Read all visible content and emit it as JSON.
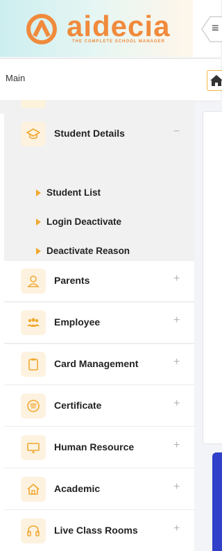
{
  "brand": {
    "name": "aidecia",
    "tagline": "THE COMPLETE SCHOOL MANAGER",
    "accent": "#f08a3c"
  },
  "header": {
    "menu_icon": "hamburger-icon"
  },
  "breadcrumb": {
    "label": "Main",
    "home_icon": "home-icon"
  },
  "sidebar": {
    "active_item": {
      "label": "Student Details",
      "icon": "graduation-cap-icon",
      "toggle": "−",
      "sub_items": [
        {
          "label": "Student List"
        },
        {
          "label": "Login Deactivate"
        },
        {
          "label": "Deactivate Reason"
        }
      ]
    },
    "items": [
      {
        "label": "Parents",
        "icon": "user-icon",
        "toggle": "+"
      },
      {
        "label": "Employee",
        "icon": "group-icon",
        "toggle": "+"
      },
      {
        "label": "Card Management",
        "icon": "clipboard-icon",
        "toggle": "+"
      },
      {
        "label": "Certificate",
        "icon": "certificate-icon",
        "toggle": "+"
      },
      {
        "label": "Human Resource",
        "icon": "monitor-icon",
        "toggle": "+"
      },
      {
        "label": "Academic",
        "icon": "home-outline-icon",
        "toggle": "+"
      },
      {
        "label": "Live Class Rooms",
        "icon": "headset-icon",
        "toggle": "+"
      }
    ]
  },
  "colors": {
    "icon_bg": "#fdf2df",
    "icon_fg": "#f0a830",
    "sub_arrow": "#f0a830",
    "content_accent": "#3040c8"
  }
}
